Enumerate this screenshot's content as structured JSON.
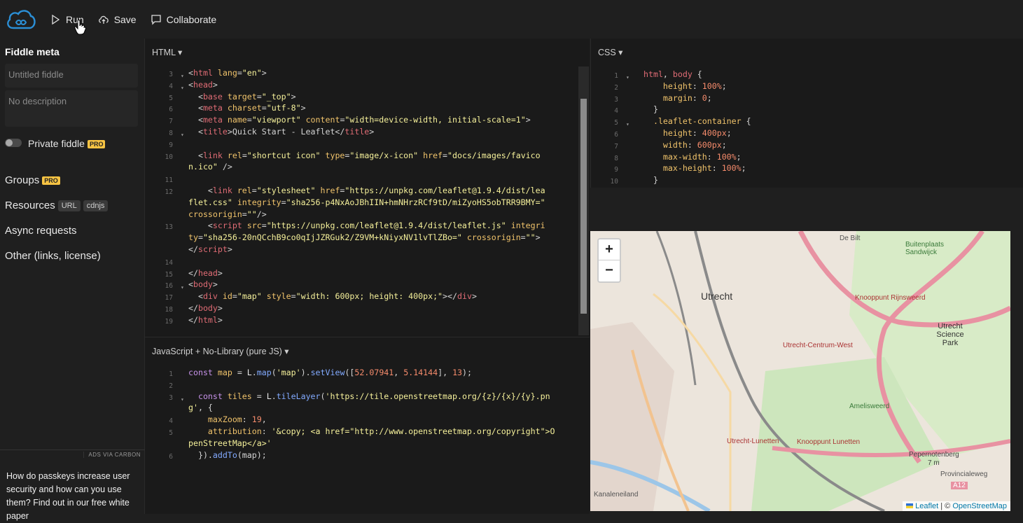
{
  "toolbar": {
    "run": "Run",
    "save": "Save",
    "collaborate": "Collaborate"
  },
  "sidebar": {
    "title": "Fiddle meta",
    "title_placeholder": "Untitled fiddle",
    "description_placeholder": "No description",
    "private_label": "Private fiddle",
    "pro_badge": "PRO",
    "groups": "Groups",
    "resources": "Resources",
    "resource_tags": [
      "URL",
      "cdnjs"
    ],
    "async": "Async requests",
    "other": "Other (links, license)",
    "ads_label": "ADS VIA CARBON",
    "ad_text": "How do passkeys increase user security and how can you use them? Find out in our free white paper"
  },
  "html_panel": {
    "title": "HTML ▾",
    "line_numbers": [
      "3",
      "4",
      "5",
      "6",
      "7",
      "8",
      "9",
      "10",
      "",
      "11",
      "12",
      "",
      "",
      "13",
      "",
      "",
      "14",
      "15",
      "16",
      "17",
      "18",
      "19"
    ]
  },
  "css_panel": {
    "title": "CSS ▾",
    "line_numbers": [
      "1",
      "2",
      "3",
      "4",
      "5",
      "6",
      "7",
      "8",
      "9",
      "10"
    ]
  },
  "js_panel": {
    "title": "JavaScript + No-Library (pure JS) ▾",
    "line_numbers": [
      "1",
      "2",
      "3",
      "",
      "4",
      "5",
      "",
      "6"
    ]
  },
  "map": {
    "zoom_in": "+",
    "zoom_out": "−",
    "labels": [
      "Utrecht",
      "Utrecht-Centrum-West",
      "Utrecht Science Park",
      "Knooppunt Rijnsweerd",
      "Utrecht-Lunetten",
      "Knooppunt Lunetten",
      "Pepernotenberg",
      "7 m",
      "Amelisweerd",
      "Buitenplaats Sandwijck",
      "De Bilt",
      "Provincialeweg",
      "Kanaleneiland",
      "A12"
    ],
    "attribution_leaflet": "Leaflet",
    "attribution_sep": " | © ",
    "attribution_osm": "OpenStreetMap"
  },
  "colors": {
    "accent": "#2b8fd6",
    "pro": "#f6c343"
  }
}
